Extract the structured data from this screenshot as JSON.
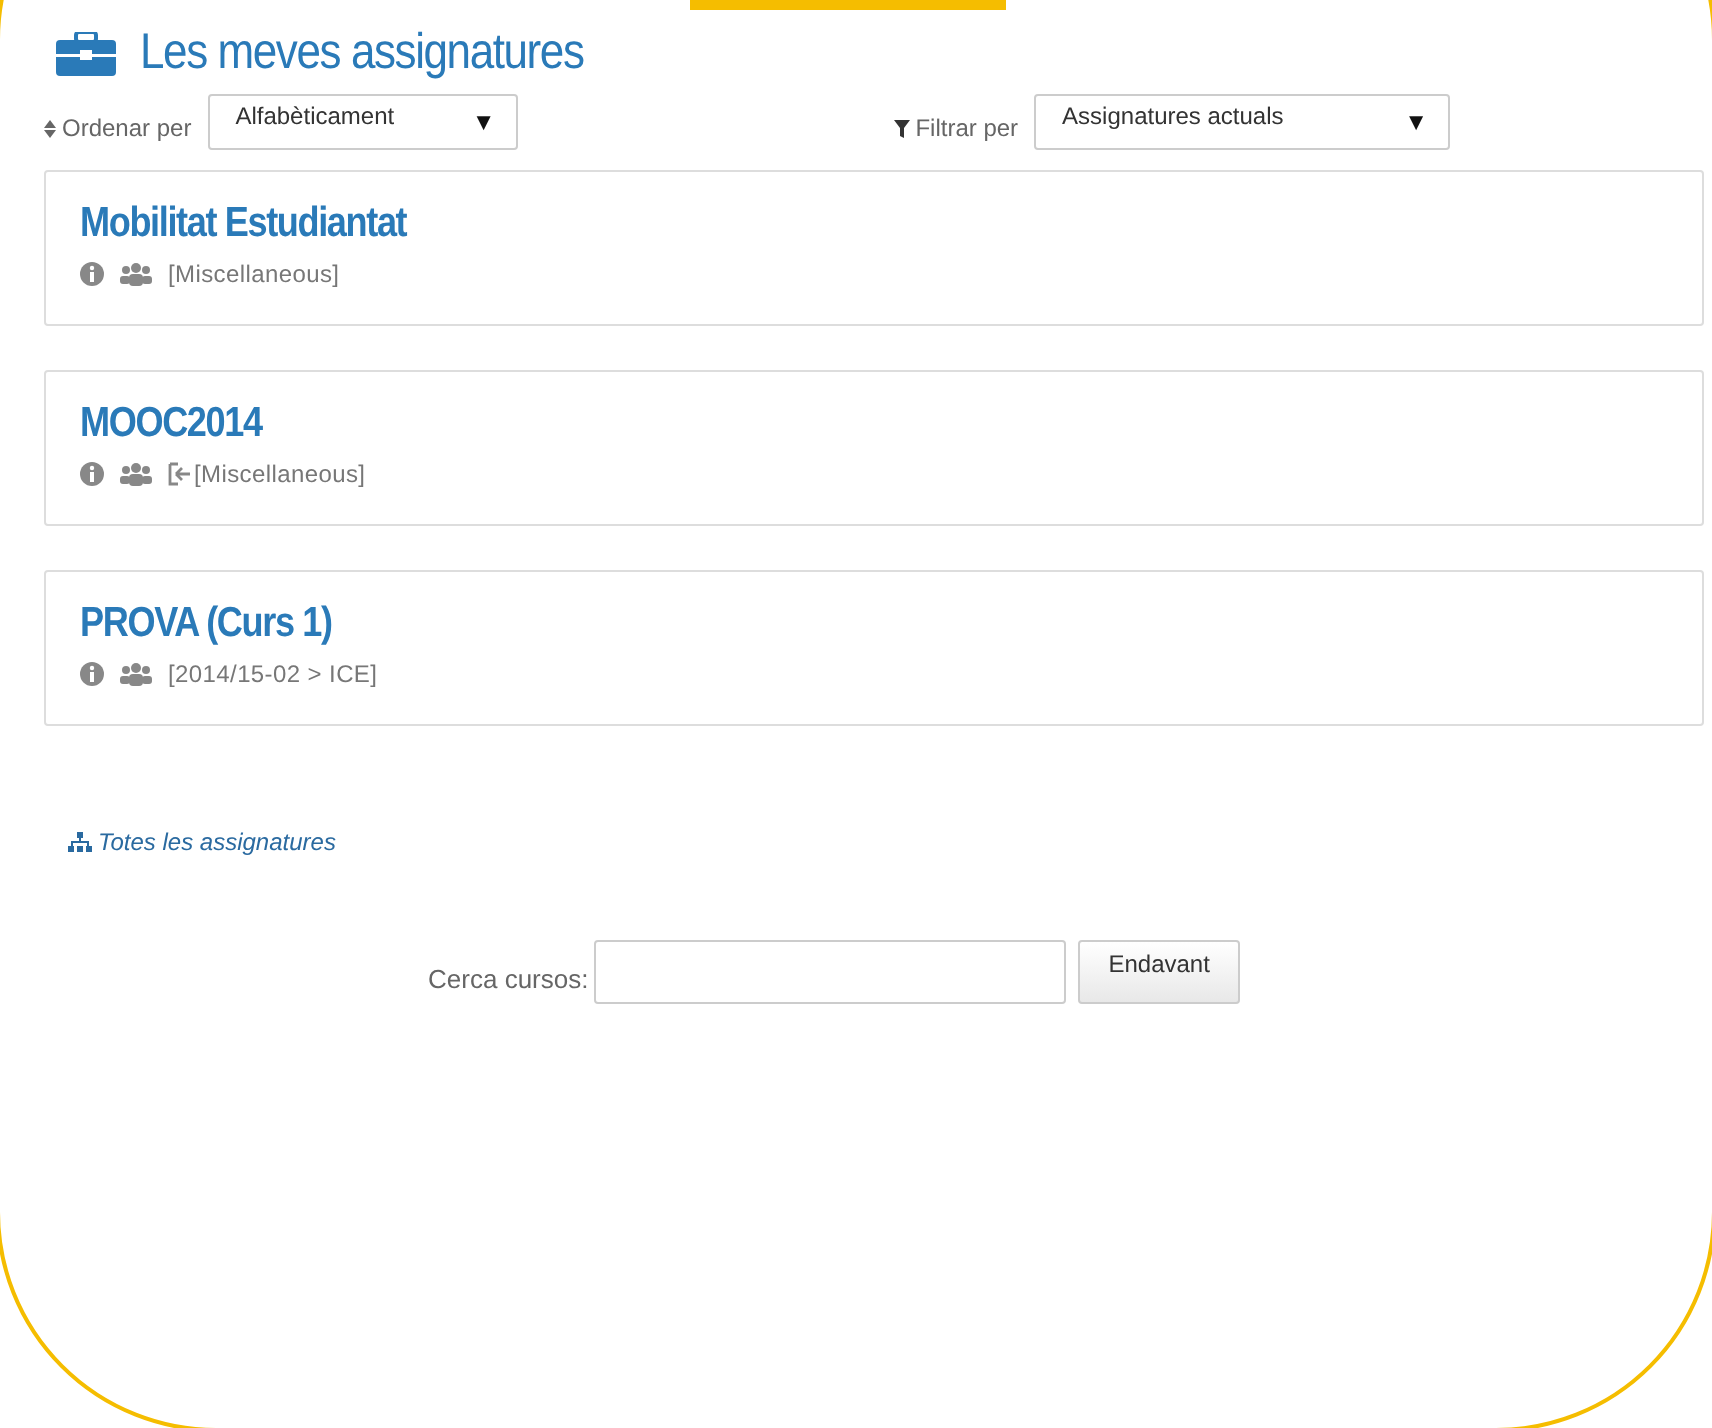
{
  "heading": {
    "title": "Les meves assignatures"
  },
  "sort": {
    "label": "Ordenar per",
    "value": "Alfabèticament",
    "caret": "▼"
  },
  "filter": {
    "label": "Filtrar per",
    "value": "Assignatures actuals",
    "caret": "▼"
  },
  "courses": [
    {
      "title": "Mobilitat Estudiantat",
      "category": "[Miscellaneous]",
      "enrol_icon": false
    },
    {
      "title": "MOOC2014",
      "category": "[Miscellaneous]",
      "enrol_icon": true
    },
    {
      "title": "PROVA (Curs 1)",
      "category": "[2014/15-02 > ICE]",
      "enrol_icon": false
    }
  ],
  "all_courses_link": "Totes les assignatures",
  "search": {
    "label": "Cerca cursos:",
    "button": "Endavant"
  }
}
